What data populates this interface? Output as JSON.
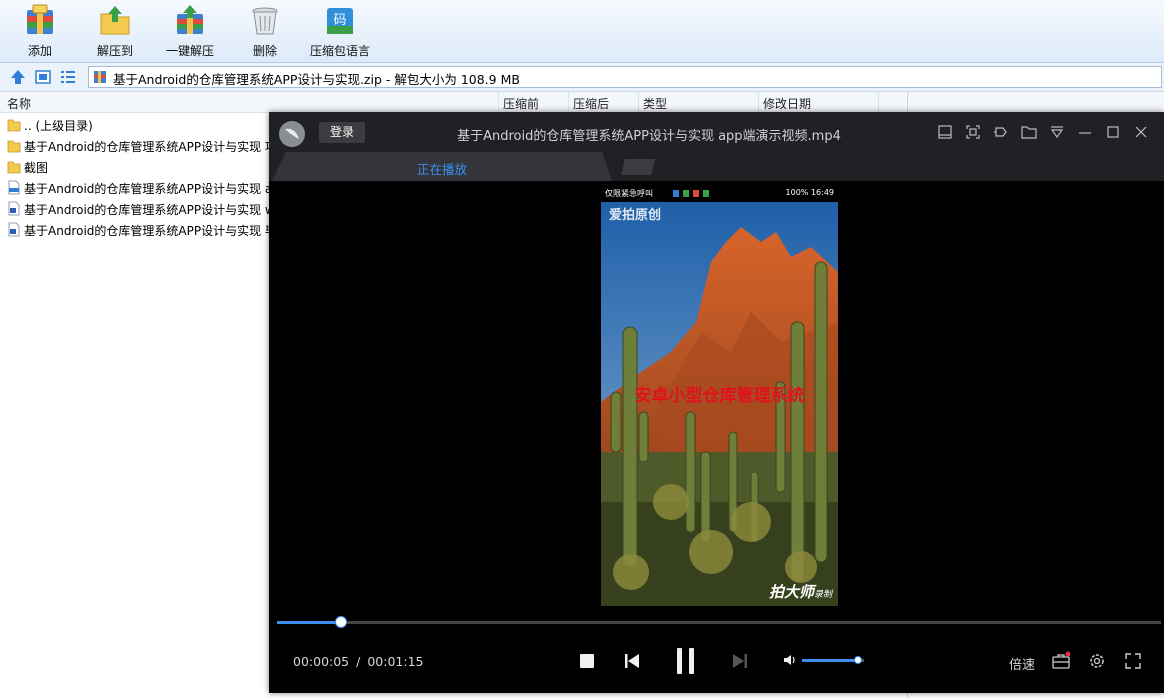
{
  "toolbar": {
    "add": "添加",
    "extract_to": "解压到",
    "one_click_extract": "一键解压",
    "delete": "删除",
    "archive_language": "压缩包语言",
    "language_icon_glyph": "码"
  },
  "addressbar": {
    "path": "基于Android的仓库管理系统APP设计与实现.zip - 解包大小为 108.9 MB"
  },
  "filelist": {
    "columns": [
      "名称",
      "压缩前",
      "压缩后",
      "类型",
      "修改日期"
    ],
    "rows": [
      {
        "name": ".. (上级目录)",
        "icon": "folder-icon"
      },
      {
        "name": "基于Android的仓库管理系统APP设计与实现 项",
        "icon": "folder-icon"
      },
      {
        "name": "截图",
        "icon": "folder-icon"
      },
      {
        "name": "基于Android的仓库管理系统APP设计与实现 a",
        "icon": "mp4-file-icon"
      },
      {
        "name": "基于Android的仓库管理系统APP设计与实现 w",
        "icon": "doc-file-icon"
      },
      {
        "name": "基于Android的仓库管理系统APP设计与实现 毕",
        "icon": "doc-file-icon"
      }
    ]
  },
  "player": {
    "login_label": "登录",
    "title": "基于Android的仓库管理系统APP设计与实现 app端演示视频.mp4",
    "tab_playing": "正在播放",
    "video": {
      "status_left": "仅限紧急呼叫",
      "status_right": "100%  16:49",
      "brand_top": "爱拍原创",
      "overlay": "安卓小型仓库管理系统",
      "brand_bottom": "拍大师",
      "brand_bottom_suffix": "录制"
    },
    "time_current": "00:00:05",
    "time_separator": "/",
    "time_total": "00:01:15",
    "progress_fraction": 0.072,
    "volume_fraction": 0.9,
    "speed_label": "倍速",
    "accent_color": "#3b8ff0"
  }
}
